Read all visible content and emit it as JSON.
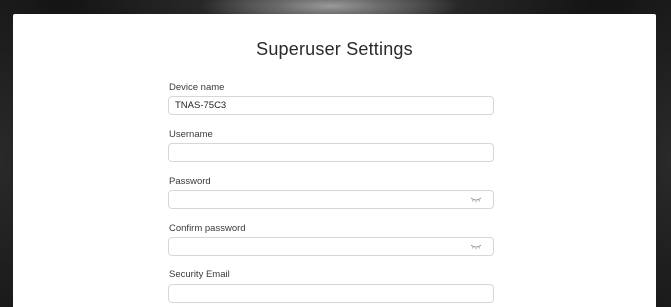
{
  "page": {
    "title": "Superuser Settings"
  },
  "form": {
    "device_name": {
      "label": "Device name",
      "value": "TNAS-75C3"
    },
    "username": {
      "label": "Username",
      "value": ""
    },
    "password": {
      "label": "Password",
      "value": "",
      "icon": "eye-closed-icon"
    },
    "confirm_password": {
      "label": "Confirm password",
      "value": "",
      "icon": "eye-closed-icon"
    },
    "security_email": {
      "label": "Security Email",
      "value": ""
    }
  }
}
